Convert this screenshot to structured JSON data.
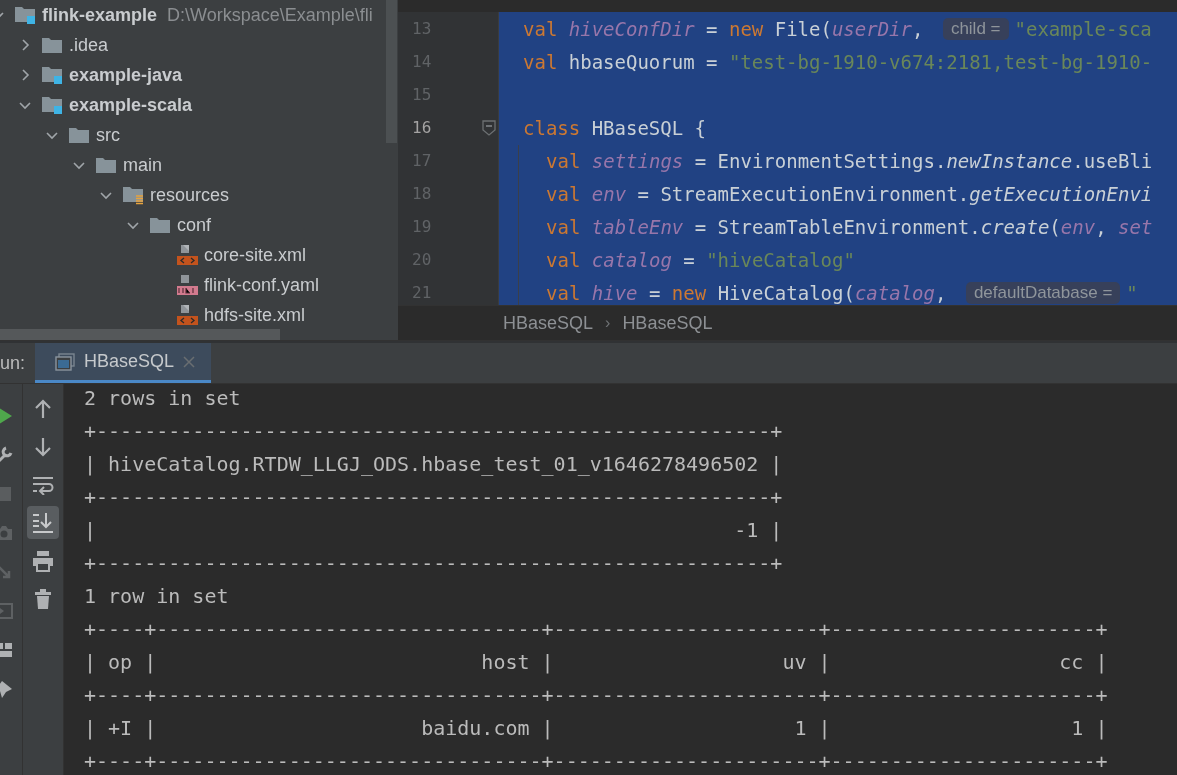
{
  "project_tree": {
    "items": [
      {
        "label": "flink-example",
        "kind": "module",
        "path": "D:\\Workspace\\Example\\fli",
        "expanded": true,
        "children": [
          {
            "label": ".idea",
            "kind": "folder",
            "expanded": false
          },
          {
            "label": "example-java",
            "kind": "module",
            "expanded": false
          },
          {
            "label": "example-scala",
            "kind": "module",
            "expanded": true,
            "children": [
              {
                "label": "src",
                "kind": "folder",
                "expanded": true,
                "children": [
                  {
                    "label": "main",
                    "kind": "folder",
                    "expanded": true,
                    "children": [
                      {
                        "label": "resources",
                        "kind": "resources",
                        "expanded": true,
                        "children": [
                          {
                            "label": "conf",
                            "kind": "folder",
                            "expanded": true,
                            "children": [
                              {
                                "label": "core-site.xml",
                                "kind": "xml"
                              },
                              {
                                "label": "flink-conf.yaml",
                                "kind": "yml"
                              },
                              {
                                "label": "hdfs-site.xml",
                                "kind": "xml"
                              }
                            ]
                          }
                        ]
                      }
                    ]
                  }
                ]
              }
            ]
          }
        ]
      }
    ]
  },
  "editor": {
    "lines": [
      {
        "number": "13",
        "current": false,
        "selected": true,
        "fold": false,
        "indent": false,
        "tokens": [
          {
            "t": "val ",
            "kind": "kw"
          },
          {
            "t": "hiveConfDir",
            "kind": "var"
          },
          {
            "t": " = ",
            "kind": "plain"
          },
          {
            "t": "new",
            "kind": "kw"
          },
          {
            "t": " File(",
            "kind": "plain"
          },
          {
            "t": "userDir",
            "kind": "var"
          },
          {
            "t": ", ",
            "kind": "plain"
          },
          {
            "t": "child =",
            "kind": "hint"
          },
          {
            "t": "\"example-sca",
            "kind": "str"
          }
        ]
      },
      {
        "number": "14",
        "current": false,
        "selected": true,
        "fold": false,
        "indent": false,
        "tokens": [
          {
            "t": "val",
            "kind": "kw"
          },
          {
            "t": " hbaseQuorum = ",
            "kind": "plain"
          },
          {
            "t": "\"test-bg-1910-v674:2181,test-bg-1910-",
            "kind": "str"
          }
        ]
      },
      {
        "number": "15",
        "current": false,
        "selected": true,
        "fold": false,
        "indent": false
      },
      {
        "number": "16",
        "current": true,
        "selected": true,
        "fold": true,
        "indent": false,
        "tokens": [
          {
            "t": "class",
            "kind": "kw"
          },
          {
            "t": " HBaseSQL {",
            "kind": "plain"
          }
        ]
      },
      {
        "number": "17",
        "current": false,
        "selected": true,
        "fold": false,
        "indent": true,
        "tokens": [
          {
            "t": "val ",
            "kind": "kw"
          },
          {
            "t": "settings",
            "kind": "var"
          },
          {
            "t": " = EnvironmentSettings.",
            "kind": "plain"
          },
          {
            "t": "newInstance",
            "kind": "call"
          },
          {
            "t": ".useBli",
            "kind": "plain"
          }
        ]
      },
      {
        "number": "18",
        "current": false,
        "selected": true,
        "fold": false,
        "indent": true,
        "tokens": [
          {
            "t": "val ",
            "kind": "kw"
          },
          {
            "t": "env",
            "kind": "var"
          },
          {
            "t": " = StreamExecutionEnvironment.",
            "kind": "plain"
          },
          {
            "t": "getExecutionEnvi",
            "kind": "call"
          }
        ]
      },
      {
        "number": "19",
        "current": false,
        "selected": true,
        "fold": false,
        "indent": true,
        "tokens": [
          {
            "t": "val ",
            "kind": "kw"
          },
          {
            "t": "tableEnv",
            "kind": "var"
          },
          {
            "t": " = StreamTableEnvironment.",
            "kind": "plain"
          },
          {
            "t": "create",
            "kind": "call"
          },
          {
            "t": "(",
            "kind": "plain"
          },
          {
            "t": "env",
            "kind": "var"
          },
          {
            "t": ", ",
            "kind": "plain"
          },
          {
            "t": "set",
            "kind": "var"
          }
        ]
      },
      {
        "number": "20",
        "current": false,
        "selected": true,
        "fold": false,
        "indent": true,
        "tokens": [
          {
            "t": "val ",
            "kind": "kw"
          },
          {
            "t": "catalog",
            "kind": "var"
          },
          {
            "t": " = ",
            "kind": "plain"
          },
          {
            "t": "\"hiveCatalog\"",
            "kind": "str"
          }
        ]
      },
      {
        "number": "21",
        "current": false,
        "selected": true,
        "fold": false,
        "indent": true,
        "tokens": [
          {
            "t": "val ",
            "kind": "kw"
          },
          {
            "t": "hive",
            "kind": "var"
          },
          {
            "t": " = ",
            "kind": "plain"
          },
          {
            "t": "new",
            "kind": "kw"
          },
          {
            "t": " HiveCatalog(",
            "kind": "plain"
          },
          {
            "t": "catalog",
            "kind": "var"
          },
          {
            "t": ", ",
            "kind": "plain"
          },
          {
            "t": "defaultDatabase =",
            "kind": "hint"
          },
          {
            "t": "\"",
            "kind": "str"
          }
        ]
      }
    ],
    "breadcrumbs": [
      "HBaseSQL",
      "HBaseSQL"
    ],
    "breadcrumb_separator": "›"
  },
  "run_panel": {
    "label": "un:",
    "tabs": [
      {
        "label": "HBaseSQL",
        "selected": true
      }
    ],
    "side_actions": [
      {
        "kind": "run"
      },
      {
        "kind": "wrench"
      },
      {
        "kind": "stop"
      },
      {
        "kind": "camera"
      },
      {
        "kind": "exit"
      },
      {
        "kind": "login"
      },
      {
        "kind": "layout"
      },
      {
        "kind": "pin"
      }
    ],
    "toolbar": [
      {
        "kind": "up",
        "on": false
      },
      {
        "kind": "down",
        "on": false
      },
      {
        "kind": "wrap",
        "on": false
      },
      {
        "kind": "scroll-end",
        "on": true
      },
      {
        "kind": "print",
        "on": false
      },
      {
        "kind": "trash",
        "on": false
      }
    ],
    "console": [
      "2 rows in set",
      "+--------------------------------------------------------+",
      "| hiveCatalog.RTDW_LLGJ_ODS.hbase_test_01_v1646278496502 |",
      "+--------------------------------------------------------+",
      "|                                                     -1 |",
      "+--------------------------------------------------------+",
      "1 row in set",
      "+----+--------------------------------+----------------------+----------------------+",
      "| op |                           host |                   uv |                   cc |",
      "+----+--------------------------------+----------------------+----------------------+",
      "| +I |                      baidu.com |                    1 |                    1 |",
      "+----+--------------------------------+----------------------+----------------------+"
    ]
  }
}
